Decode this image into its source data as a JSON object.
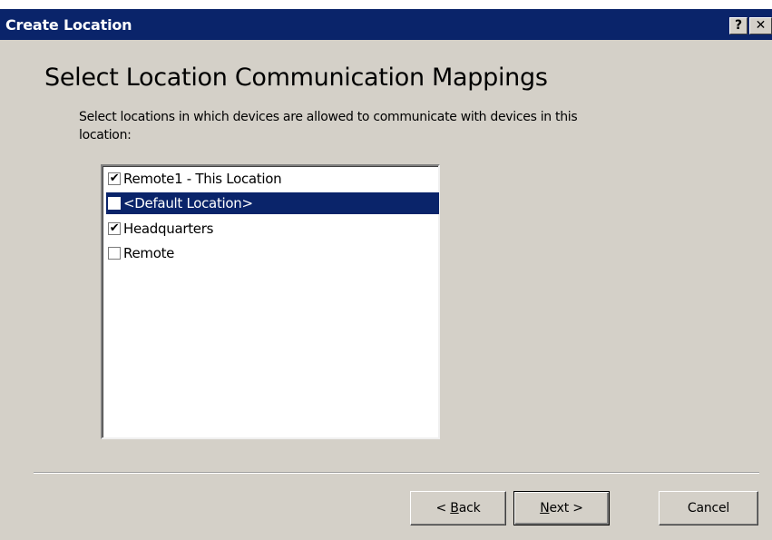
{
  "window": {
    "title": "Create Location",
    "help_glyph": "?",
    "close_glyph": "✕"
  },
  "page": {
    "heading": "Select Location Communication Mappings",
    "instructions": "Select locations in which devices are allowed to communicate with devices in this location:"
  },
  "locations": {
    "items": [
      {
        "label": "Remote1 - This Location",
        "checked": true,
        "selected": false,
        "mark": "✔"
      },
      {
        "label": "<Default Location>",
        "checked": false,
        "selected": true,
        "mark": ""
      },
      {
        "label": "Headquarters",
        "checked": true,
        "selected": false,
        "mark": "✔"
      },
      {
        "label": "Remote",
        "checked": false,
        "selected": false,
        "mark": ""
      }
    ]
  },
  "buttons": {
    "back_prefix": "< ",
    "back_mnemonic": "B",
    "back_rest": "ack",
    "next_mnemonic": "N",
    "next_rest": "ext >",
    "cancel": "Cancel"
  },
  "colors": {
    "titlebar": "#0a246a",
    "selection": "#0a246a",
    "dialog_face": "#d4d0c8"
  }
}
